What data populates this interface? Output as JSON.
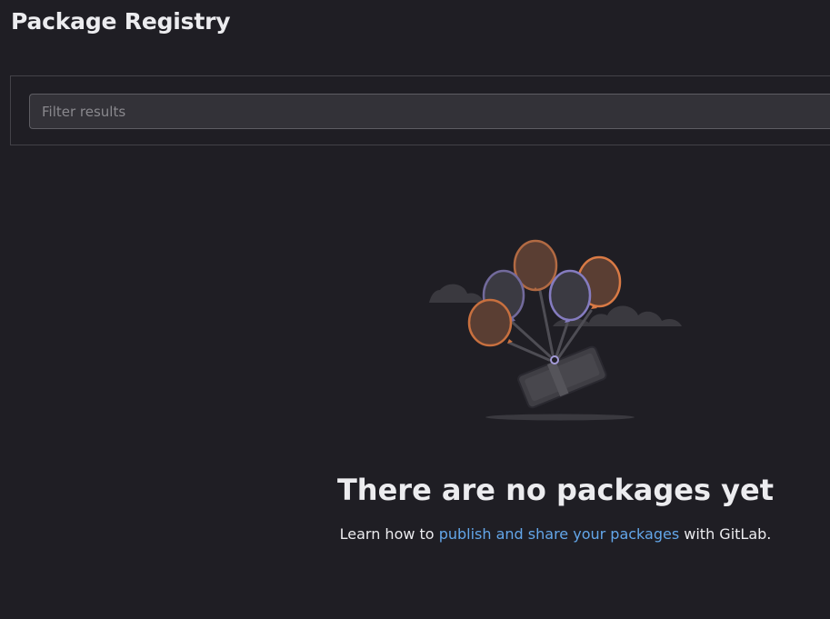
{
  "header": {
    "title": "Package Registry"
  },
  "filter": {
    "placeholder": "Filter results",
    "value": ""
  },
  "empty_state": {
    "title": "There are no packages yet",
    "description_before": "Learn how to ",
    "link_text": "publish and share your packages",
    "description_after": " with GitLab.",
    "illustration": "balloons-lifting-package-illustration"
  },
  "colors": {
    "background": "#1f1e24",
    "text": "#ececef",
    "link": "#63a6e9",
    "balloon_orange": "#e9854b",
    "balloon_purple": "#8a7fc4",
    "input_bg": "#333238"
  }
}
